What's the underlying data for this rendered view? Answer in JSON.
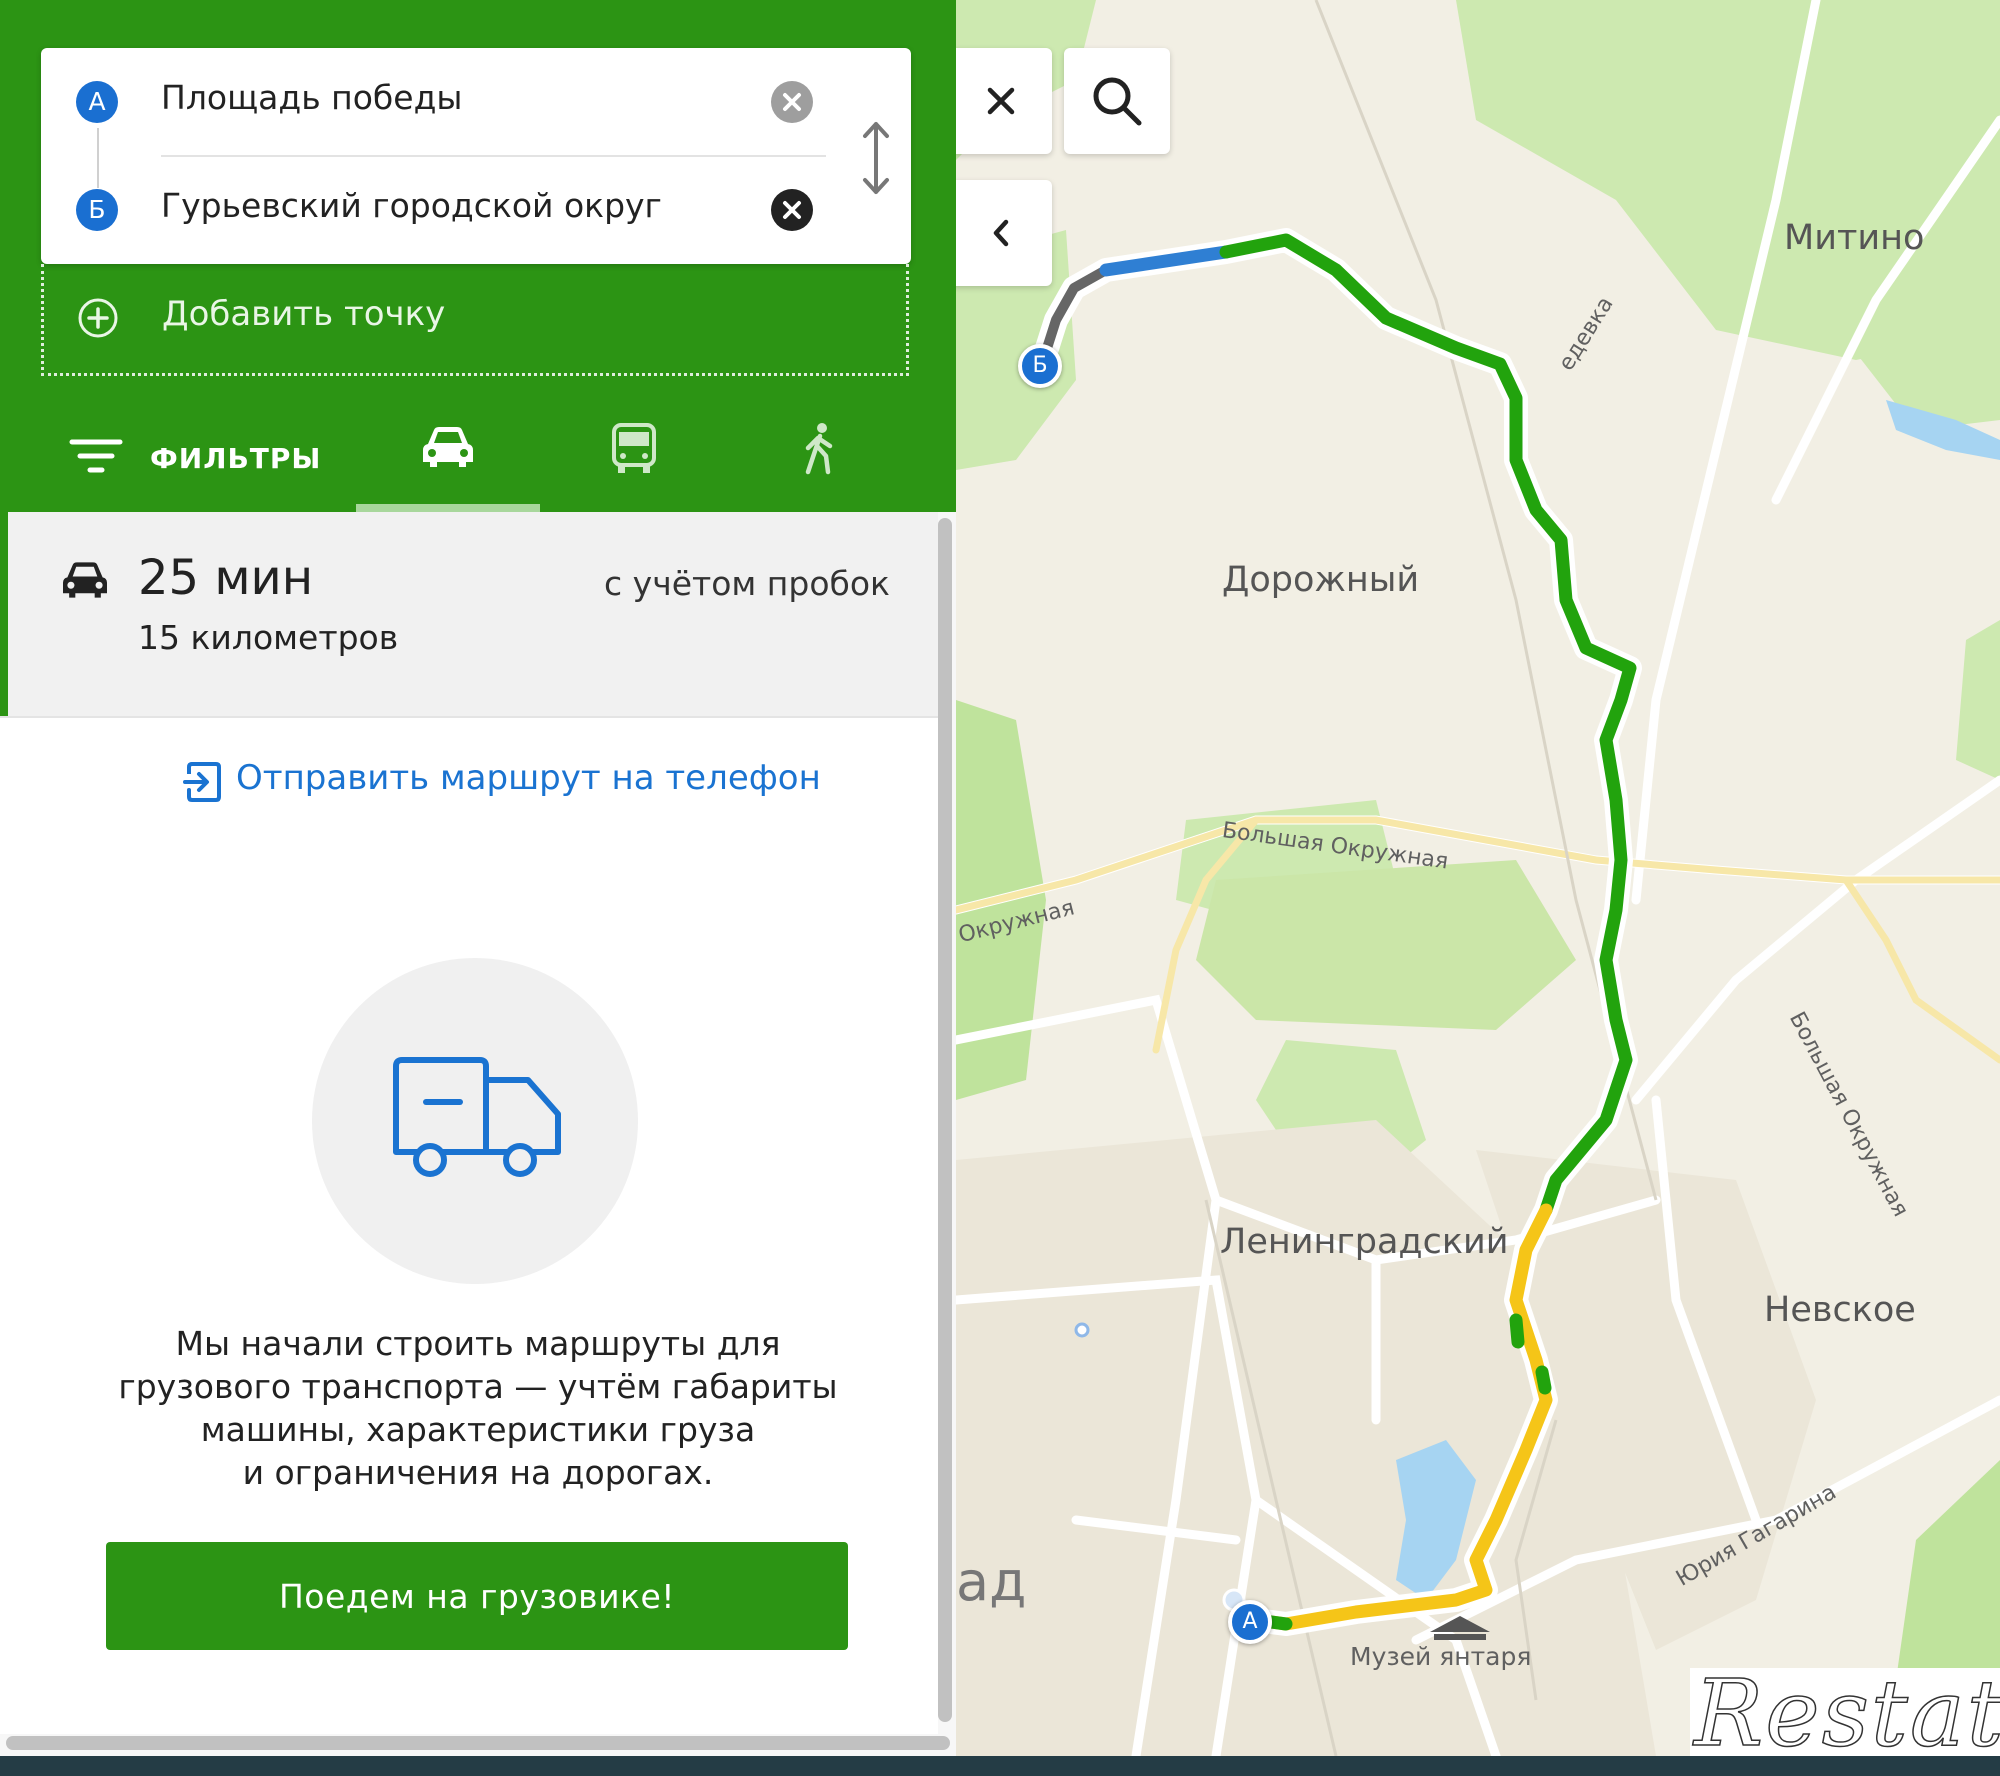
{
  "route": {
    "point_a": {
      "badge": "А",
      "value": "Площадь победы"
    },
    "point_b": {
      "badge": "Б",
      "value": "Гурьевский городской округ"
    },
    "add_point": "Добавить точку"
  },
  "tabs": {
    "filters": "ФИЛЬТРЫ",
    "active": "car"
  },
  "summary": {
    "time": "25 мин",
    "distance": "15 километров",
    "traffic": "с учётом пробок"
  },
  "send_to_phone": "Отправить маршрут на телефон",
  "promo": {
    "lines": [
      "Мы начали строить маршруты для",
      "грузового транспорта — учтём габариты",
      "машины, характеристики груза",
      "и ограничения на дорогах."
    ],
    "button": "Поедем на грузовике!"
  },
  "map": {
    "labels": {
      "mitino": "Митино",
      "dorozhny": "Дорожный",
      "leningradsky": "Ленинградский",
      "nevskoe": "Невское",
      "bolshaya_okruzhnaya_1": "Большая Окружная",
      "okruzhnaya": "Окружная",
      "bolshaya_okruzhnaya_2": "Большая Окружная",
      "yuriya_gagarina": "Юрия Гагарина",
      "muzey_yantarya": "Музей янтаря",
      "road_fragment": "едевка",
      "city_fragment": "ад"
    },
    "markers": {
      "a": "А",
      "b": "Б"
    }
  },
  "watermark": "Restate",
  "colors": {
    "brand_green": "#2c9414",
    "route_green": "#22a30d",
    "route_yellow": "#f5c518",
    "route_blue": "#2f7fd3",
    "link_blue": "#1a73d1"
  }
}
